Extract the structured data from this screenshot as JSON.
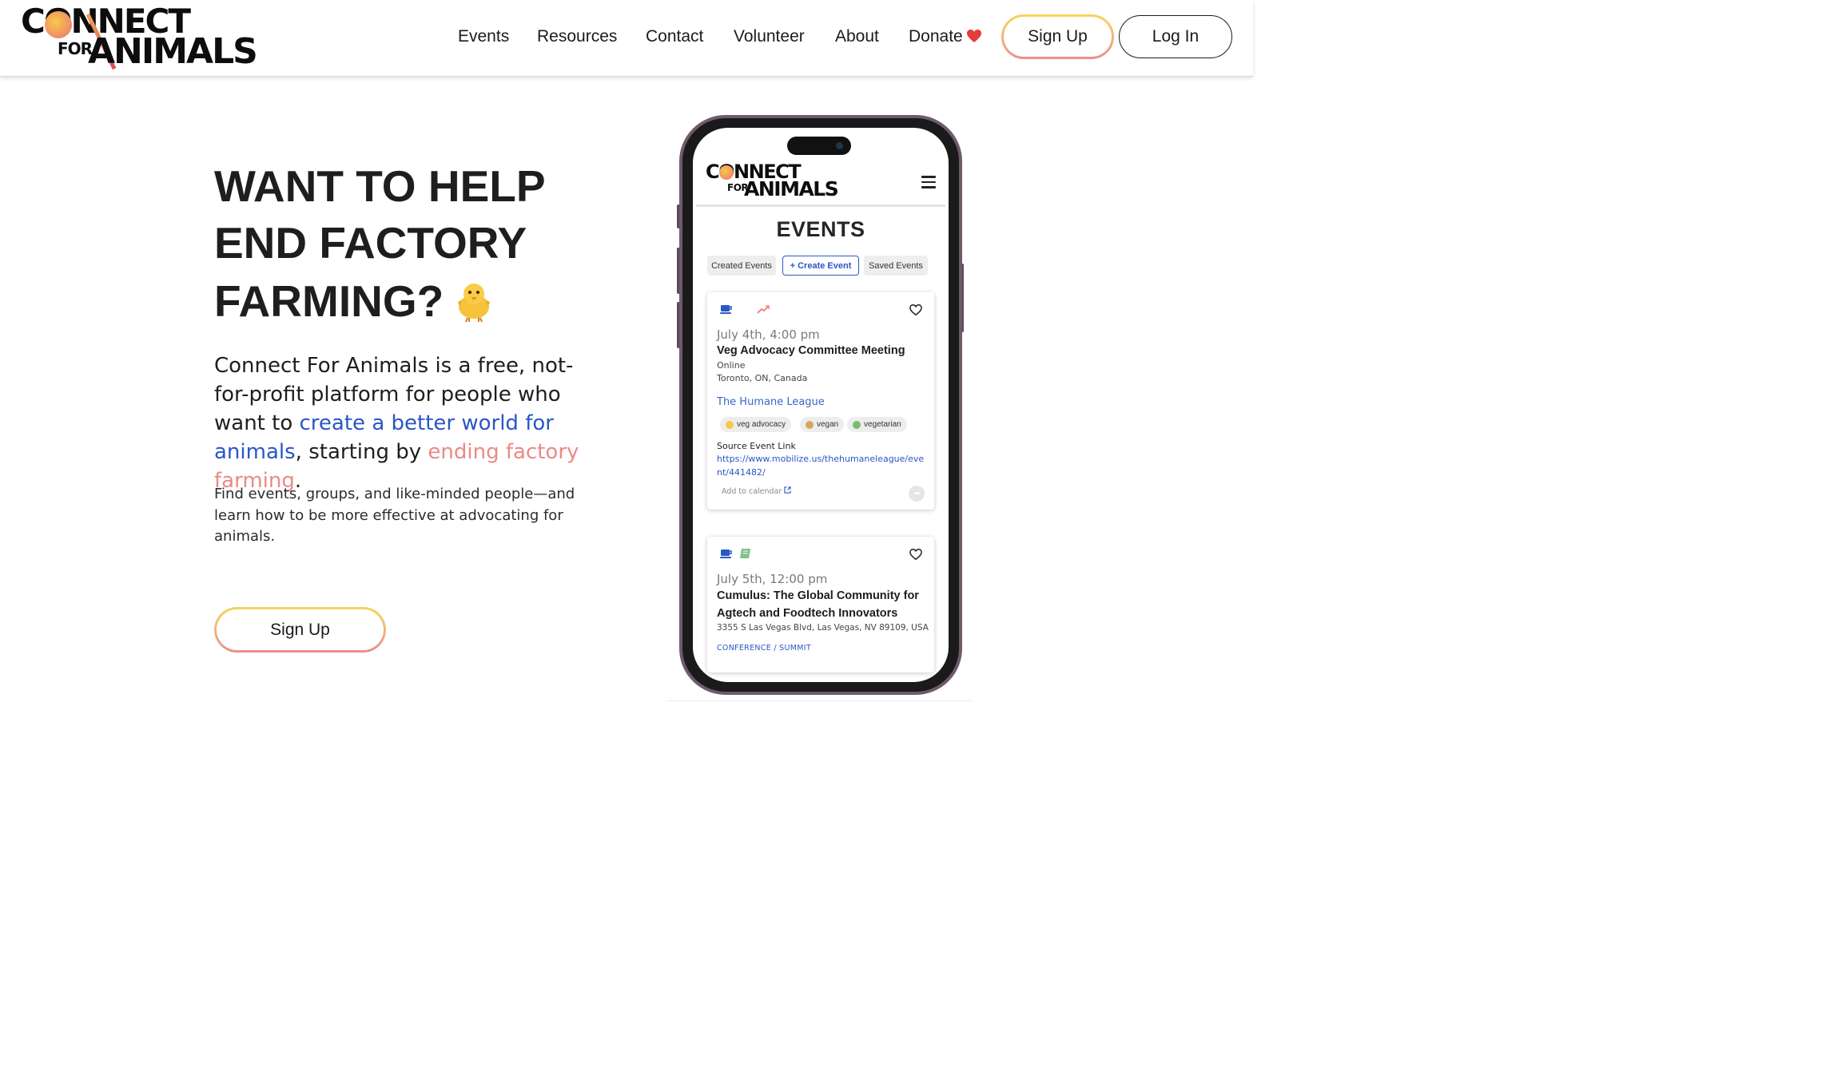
{
  "brand": {
    "logo_line1": "CONNECT",
    "logo_for": "FOR",
    "logo_line2": "ANIMALS"
  },
  "nav": {
    "items": [
      "Events",
      "Resources",
      "Contact",
      "Volunteer",
      "About",
      "Donate"
    ],
    "signup_label": "Sign Up",
    "login_label": "Log In"
  },
  "hero": {
    "headline_1": "WANT TO HELP",
    "headline_2": "END FACTORY",
    "headline_3": "FARMING?",
    "lead_part1": "Connect For Animals is a free, not-for-profit platform for people who want to ",
    "lead_link1": "create a better world for animals",
    "lead_part2": ", starting by ",
    "lead_link2": "ending factory farming",
    "lead_part3": ".",
    "sub": "Find events, groups, and like-minded people—and learn how to be more effective at advocating for animals.",
    "cta_label": "Sign Up"
  },
  "phone": {
    "logo_line1": "CONNECT",
    "logo_for": "FOR",
    "logo_line2": "ANIMALS",
    "title": "EVENTS",
    "tabs": [
      "Created Events",
      "+ Create Event",
      "Saved Events"
    ],
    "events": [
      {
        "date": "July 4th, 4:00 pm",
        "title": "Veg Advocacy Committee Meeting",
        "location_type": "Online",
        "location": "Toronto, ON, Canada",
        "org": "The Humane League",
        "tags": [
          "veg advocacy",
          "vegan",
          "vegetarian"
        ],
        "source_label": "Source Event Link",
        "source_url": "https://www.mobilize.us/thehumaneleague/event/441482/",
        "calendar_label": "Add to calendar",
        "more_label": "•••"
      },
      {
        "date": "July 5th, 12:00 pm",
        "title": "Cumulus: The Global Community for Agtech and Foodtech Innovators",
        "location": "3355 S Las Vegas Blvd, Las Vegas, NV 89109, USA",
        "category": "CONFERENCE / SUMMIT"
      }
    ]
  },
  "colors": {
    "accent_blue": "#2a56c6",
    "accent_pink": "#e98b85",
    "gradient_yellow": "#f5d65c",
    "gradient_pink": "#ea8e8e",
    "text_dark": "#1e1e1e"
  },
  "icons": [
    "hamburger-menu-icon",
    "heart-icon",
    "chick-emoji-icon",
    "coffee-icon",
    "trend-chart-icon",
    "book-icon",
    "external-link-icon",
    "more-icon"
  ]
}
